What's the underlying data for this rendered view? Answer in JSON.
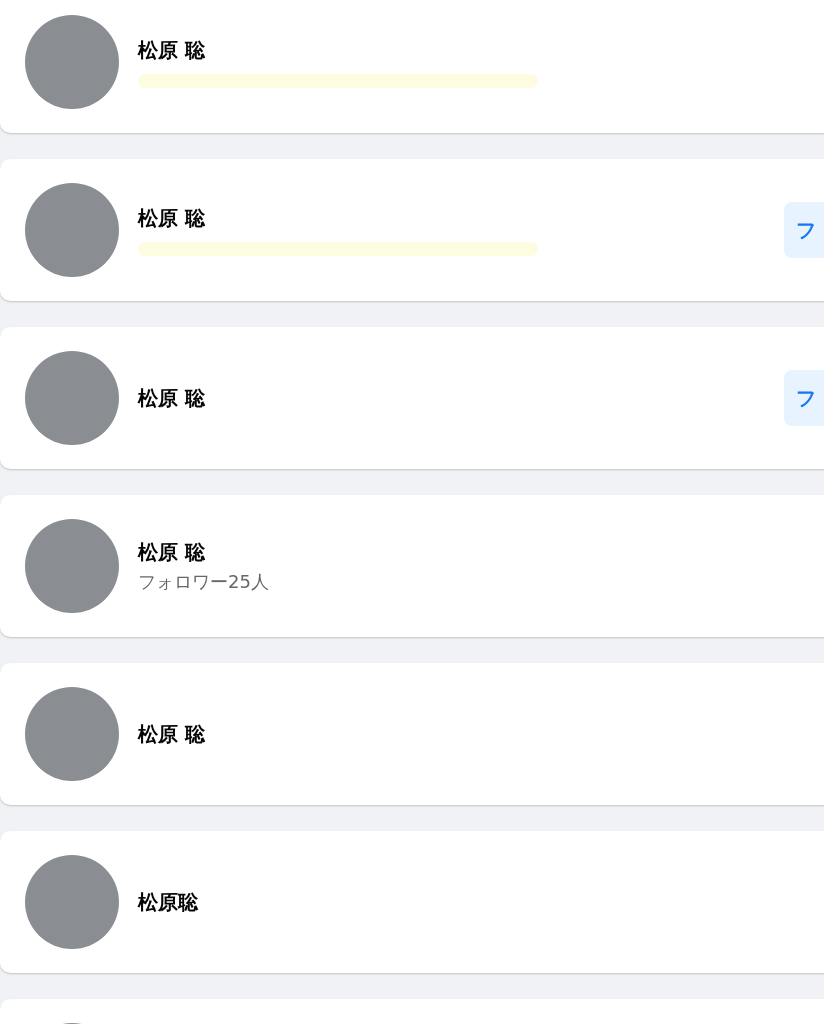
{
  "people": [
    {
      "name": "松原 聡",
      "subtitle_redacted": true
    },
    {
      "name": "松原 聡",
      "subtitle_redacted": true,
      "follow_button": "フ"
    },
    {
      "name": "松原 聡",
      "subtitle_redacted": false,
      "follow_button": "フ"
    },
    {
      "name": "松原 聡",
      "subtitle": "フォロワー25人",
      "subtitle_redacted": false
    },
    {
      "name": "松原 聡",
      "subtitle_redacted": false
    },
    {
      "name": "松原聡",
      "subtitle_redacted": false
    },
    {
      "subtitle_redacted": false
    }
  ]
}
